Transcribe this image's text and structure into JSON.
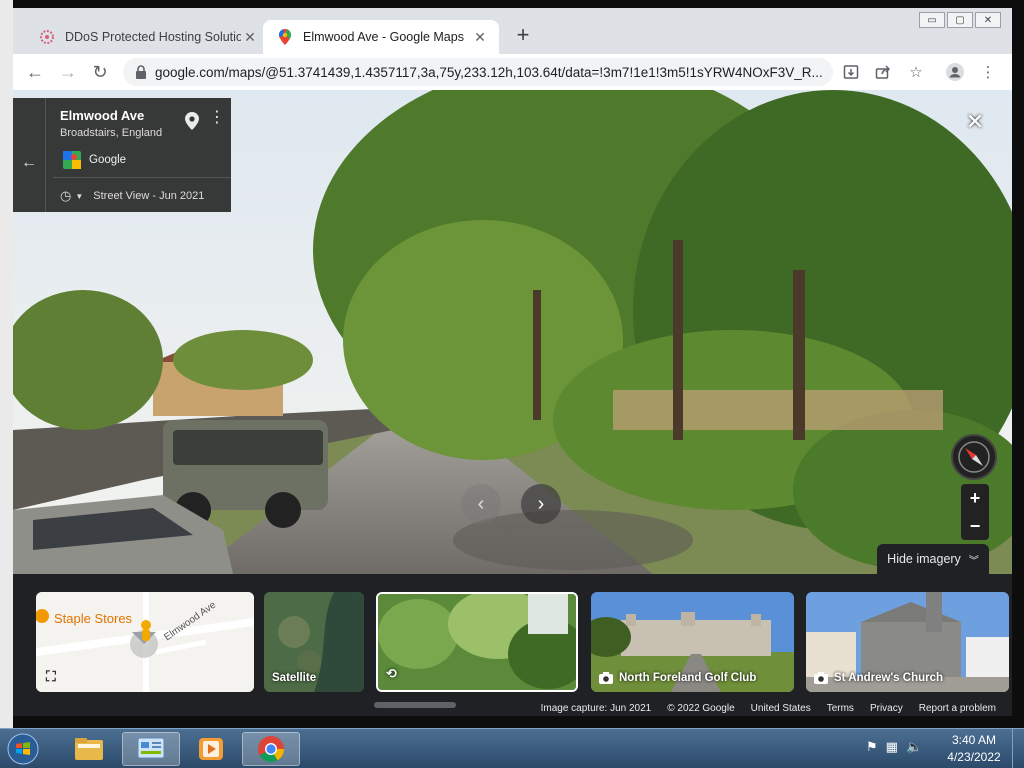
{
  "browser": {
    "tabs": [
      {
        "title": "DDoS Protected Hosting Solution",
        "active": false
      },
      {
        "title": "Elmwood Ave - Google Maps",
        "active": true
      }
    ],
    "url": "google.com/maps/@51.3741439,1.4357117,3a,75y,233.12h,103.64t/data=!3m7!1e1!3m5!1sYRW4NOxF3V_R...",
    "window_controls": [
      "▭",
      "▢",
      "✕"
    ]
  },
  "streetview": {
    "street": "Elmwood Ave",
    "town": "Broadstairs, England",
    "provider": "Google",
    "capture": "Street View - Jun 2021",
    "hide_imagery": "Hide imagery"
  },
  "filmstrip": {
    "map_label": "Staple Stores",
    "map_road": "Elmwood Ave",
    "satellite": "Satellite",
    "photos": [
      {
        "label": "North Foreland Golf Club"
      },
      {
        "label": "St Andrew's Church"
      }
    ]
  },
  "footer": {
    "items": [
      "Image capture: Jun 2021",
      "© 2022 Google",
      "United States",
      "Terms",
      "Privacy",
      "Report a problem"
    ]
  },
  "taskbar": {
    "time": "3:40 AM",
    "date": "4/23/2022"
  },
  "colors": {
    "accent": "#1a73e8",
    "page_bg": "#202124"
  }
}
